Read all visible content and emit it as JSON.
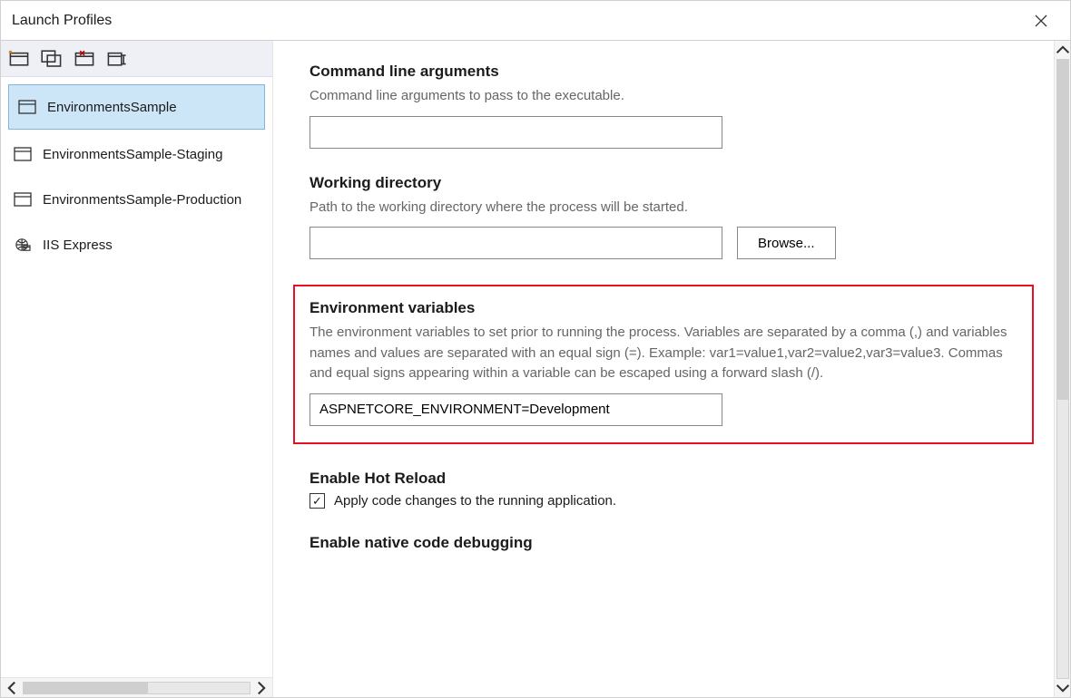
{
  "window": {
    "title": "Launch Profiles"
  },
  "toolbar": {
    "buttons": [
      "new-profile",
      "duplicate-profile",
      "delete-profile",
      "rename-profile"
    ]
  },
  "profiles": {
    "items": [
      {
        "label": "EnvironmentsSample",
        "icon": "window",
        "selected": true
      },
      {
        "label": "EnvironmentsSample-Staging",
        "icon": "window",
        "selected": false
      },
      {
        "label": "EnvironmentsSample-Production",
        "icon": "window",
        "selected": false
      },
      {
        "label": "IIS Express",
        "icon": "globe",
        "selected": false
      }
    ]
  },
  "form": {
    "commandLine": {
      "title": "Command line arguments",
      "desc": "Command line arguments to pass to the executable.",
      "value": ""
    },
    "workingDir": {
      "title": "Working directory",
      "desc": "Path to the working directory where the process will be started.",
      "value": "",
      "browse": "Browse..."
    },
    "envVars": {
      "title": "Environment variables",
      "desc": "The environment variables to set prior to running the process. Variables are separated by a comma (,) and variables names and values are separated with an equal sign (=). Example: var1=value1,var2=value2,var3=value3. Commas and equal signs appearing within a variable can be escaped using a forward slash (/).",
      "value": "ASPNETCORE_ENVIRONMENT=Development"
    },
    "hotReload": {
      "title": "Enable Hot Reload",
      "checkboxLabel": "Apply code changes to the running application.",
      "checked": true
    },
    "nativeDebug": {
      "title": "Enable native code debugging"
    }
  }
}
